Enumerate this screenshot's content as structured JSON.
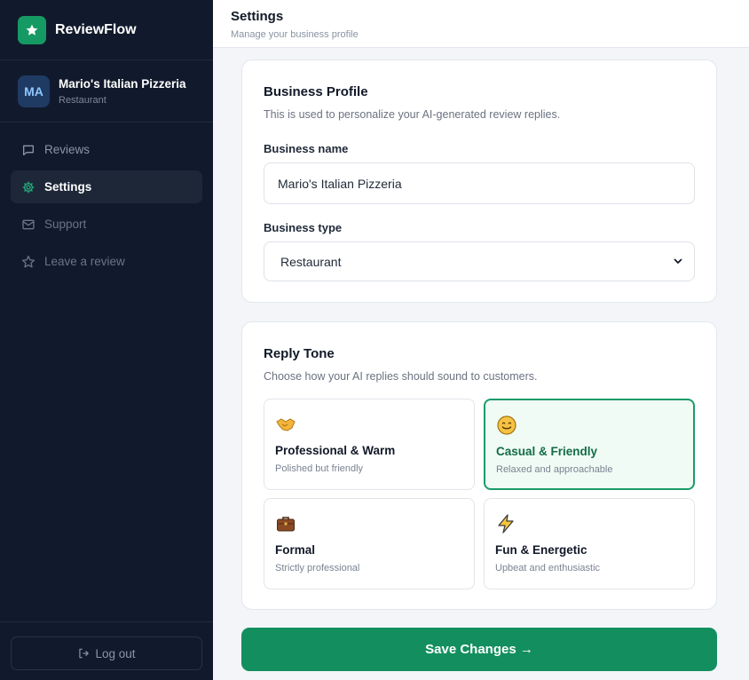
{
  "app": {
    "name": "ReviewFlow"
  },
  "business": {
    "initials": "MA",
    "name": "Mario's Italian Pizzeria",
    "type": "Restaurant"
  },
  "nav": {
    "items": [
      {
        "label": "Reviews",
        "icon": "chat-bubble-icon",
        "active": false
      },
      {
        "label": "Settings",
        "icon": "gear-icon",
        "active": true
      },
      {
        "label": "Support",
        "icon": "mail-icon",
        "active": false
      },
      {
        "label": "Leave a review",
        "icon": "star-icon",
        "active": false
      }
    ],
    "logout_label": "Log out"
  },
  "header": {
    "title": "Settings",
    "subtitle": "Manage your business profile"
  },
  "profile": {
    "title": "Business Profile",
    "description": "This is used to personalize your AI-generated review replies.",
    "name_label": "Business name",
    "name_value": "Mario's Italian Pizzeria",
    "type_label": "Business type",
    "type_value": "Restaurant"
  },
  "tone": {
    "title": "Reply Tone",
    "description": "Choose how your AI replies should sound to customers.",
    "options": [
      {
        "label": "Professional & Warm",
        "desc": "Polished but friendly",
        "icon": "handshake-icon",
        "selected": false
      },
      {
        "label": "Casual & Friendly",
        "desc": "Relaxed and approachable",
        "icon": "smiley-icon",
        "selected": true
      },
      {
        "label": "Formal",
        "desc": "Strictly professional",
        "icon": "briefcase-icon",
        "selected": false
      },
      {
        "label": "Fun & Energetic",
        "desc": "Upbeat and enthusiastic",
        "icon": "lightning-icon",
        "selected": false
      }
    ]
  },
  "save_label": "Save Changes →",
  "colors": {
    "sidebar_bg": "#111a2c",
    "accent": "#138f5f",
    "selected_bg": "#effbf4"
  }
}
